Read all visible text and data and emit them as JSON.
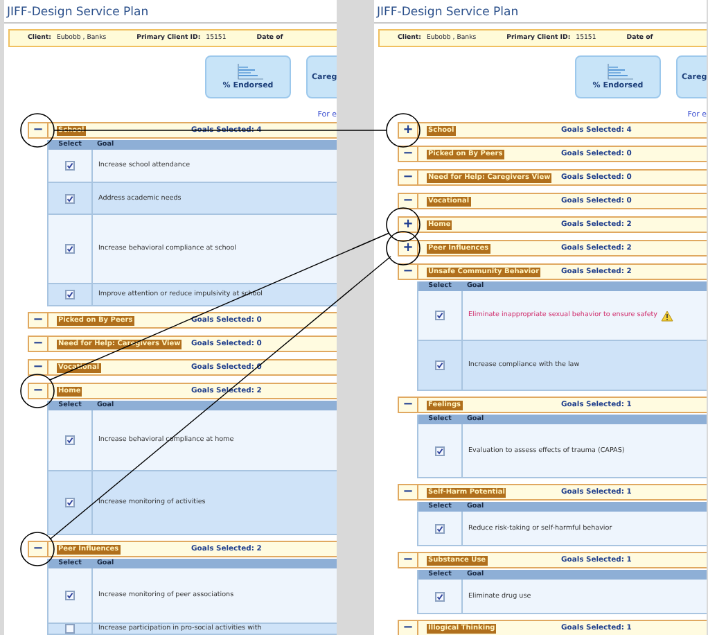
{
  "panels": [
    {
      "title": "JIFF-Design Service Plan",
      "client_bar": [
        {
          "label": "Client:",
          "value": "Eubobb , Banks"
        },
        {
          "label": "Primary Client ID:",
          "value": "15151"
        },
        {
          "label": "Date of"
        }
      ],
      "chart_buttons": [
        "% Endorsed",
        "Careg"
      ],
      "link": "For e",
      "sections": [
        {
          "toggle": "−",
          "label": "School",
          "count": "Goals Selected: 4",
          "columns": [
            "Select",
            "Goal"
          ],
          "goals": [
            {
              "checked": true,
              "warning": false,
              "text": "Increase school attendance"
            },
            {
              "checked": true,
              "warning": false,
              "text": "Address academic needs"
            },
            {
              "checked": true,
              "warning": false,
              "text": "Increase behavioral compliance at school"
            },
            {
              "checked": true,
              "warning": false,
              "text": "Improve attention or reduce impulsivity at school"
            }
          ]
        },
        {
          "toggle": "−",
          "label": "Picked on By Peers",
          "count": "Goals Selected: 0"
        },
        {
          "toggle": "−",
          "label": "Need for Help: Caregivers View",
          "count": "Goals Selected: 0"
        },
        {
          "toggle": "−",
          "label": "Vocational",
          "count": "Goals Selected: 0"
        },
        {
          "toggle": "−",
          "label": "Home",
          "count": "Goals Selected: 2",
          "columns": [
            "Select",
            "Goal"
          ],
          "goals": [
            {
              "checked": true,
              "warning": false,
              "text": "Increase behavioral compliance at home"
            },
            {
              "checked": true,
              "warning": false,
              "text": "Increase monitoring of activities"
            }
          ]
        },
        {
          "toggle": "−",
          "label": "Peer Influences",
          "count": "Goals Selected: 2",
          "columns": [
            "Select",
            "Goal"
          ],
          "goals": [
            {
              "checked": true,
              "warning": false,
              "text": "Increase monitoring of peer associations"
            },
            {
              "checked": false,
              "warning": false,
              "text": "Increase participation in pro-social activities with"
            }
          ]
        }
      ]
    },
    {
      "title": "JIFF-Design Service Plan",
      "client_bar": [
        {
          "label": "Client:",
          "value": "Eubobb , Banks"
        },
        {
          "label": "Primary Client ID:",
          "value": "15151"
        },
        {
          "label": "Date of"
        }
      ],
      "chart_buttons": [
        "% Endorsed",
        "Careg"
      ],
      "link": "For e",
      "sections": [
        {
          "toggle": "+",
          "label": "School",
          "count": "Goals Selected: 4"
        },
        {
          "toggle": "−",
          "label": "Picked on By Peers",
          "count": "Goals Selected: 0"
        },
        {
          "toggle": "−",
          "label": "Need for Help: Caregivers View",
          "count": "Goals Selected: 0"
        },
        {
          "toggle": "−",
          "label": "Vocational",
          "count": "Goals Selected: 0"
        },
        {
          "toggle": "+",
          "label": "Home",
          "count": "Goals Selected: 2"
        },
        {
          "toggle": "+",
          "label": "Peer Influences",
          "count": "Goals Selected: 2"
        },
        {
          "toggle": "−",
          "label": "Unsafe Community Behavior",
          "count": "Goals Selected: 2",
          "columns": [
            "Select",
            "Goal"
          ],
          "goals": [
            {
              "checked": true,
              "warning": true,
              "text": "Eliminate inappropriate sexual behavior to ensure safety"
            },
            {
              "checked": true,
              "warning": false,
              "text": "Increase compliance with the law"
            }
          ]
        },
        {
          "toggle": "−",
          "label": "Feelings",
          "count": "Goals Selected: 1",
          "columns": [
            "Select",
            "Goal"
          ],
          "goals": [
            {
              "checked": true,
              "warning": false,
              "text": "Evaluation to assess effects of trauma (CAPAS)"
            }
          ]
        },
        {
          "toggle": "−",
          "label": "Self-Harm Potential",
          "count": "Goals Selected: 1",
          "columns": [
            "Select",
            "Goal"
          ],
          "goals": [
            {
              "checked": true,
              "warning": false,
              "text": "Reduce risk-taking or self-harmful behavior"
            }
          ]
        },
        {
          "toggle": "−",
          "label": "Substance Use",
          "count": "Goals Selected: 1",
          "columns": [
            "Select",
            "Goal"
          ],
          "goals": [
            {
              "checked": true,
              "warning": false,
              "text": "Eliminate drug use"
            }
          ]
        },
        {
          "toggle": "−",
          "label": "Illogical Thinking",
          "count": "Goals Selected: 1"
        }
      ]
    }
  ]
}
